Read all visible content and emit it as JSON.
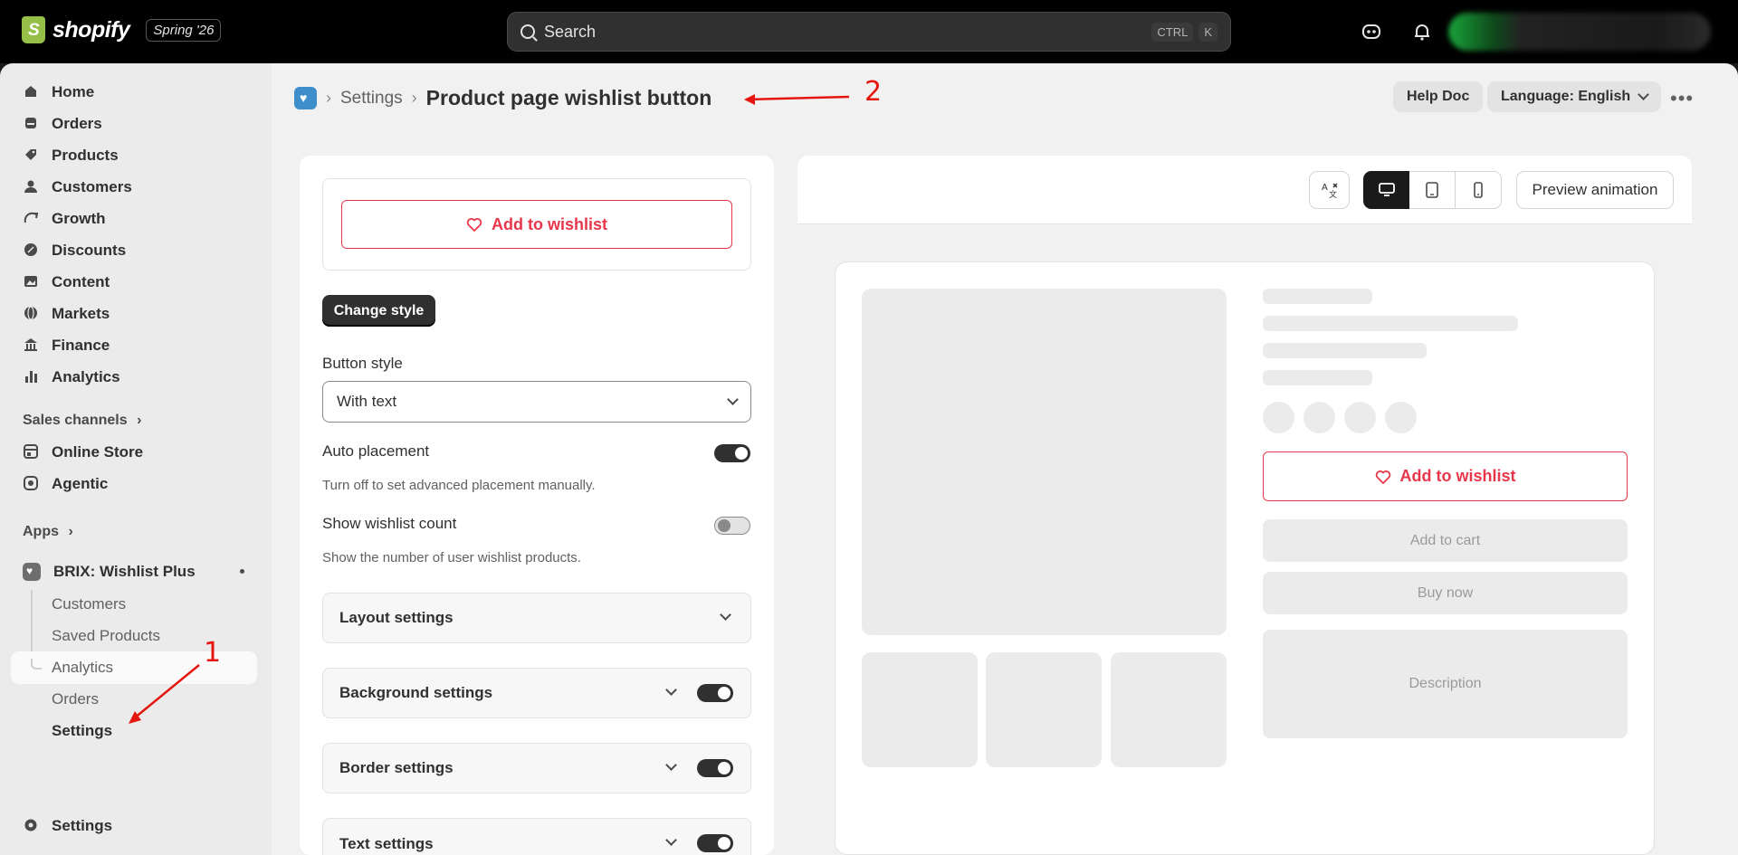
{
  "topbar": {
    "brand": "shopify",
    "edition": "Spring '26",
    "search_placeholder": "Search",
    "shortcut_ctrl": "CTRL",
    "shortcut_key": "K"
  },
  "sidebar": {
    "items": [
      {
        "label": "Home",
        "icon": "home-icon"
      },
      {
        "label": "Orders",
        "icon": "inbox-icon"
      },
      {
        "label": "Products",
        "icon": "tag-icon"
      },
      {
        "label": "Customers",
        "icon": "person-icon"
      },
      {
        "label": "Growth",
        "icon": "growth-icon"
      },
      {
        "label": "Discounts",
        "icon": "discount-icon"
      },
      {
        "label": "Content",
        "icon": "image-icon"
      },
      {
        "label": "Markets",
        "icon": "globe-icon"
      },
      {
        "label": "Finance",
        "icon": "bank-icon"
      },
      {
        "label": "Analytics",
        "icon": "bar-chart-icon"
      }
    ],
    "sales_channels_label": "Sales channels",
    "sales_channels": [
      {
        "label": "Online Store",
        "icon": "store-icon"
      },
      {
        "label": "Agentic",
        "icon": "agent-icon"
      }
    ],
    "apps_label": "Apps",
    "app_name": "BRIX: Wishlist Plus",
    "app_subitems": [
      "Customers",
      "Saved Products",
      "Analytics",
      "Orders",
      "Settings"
    ],
    "footer_settings": "Settings"
  },
  "header": {
    "crumb_settings": "Settings",
    "page_title": "Product page wishlist button",
    "help_doc": "Help Doc",
    "language": "Language: English"
  },
  "annotations": {
    "one": "1",
    "two": "2"
  },
  "settings": {
    "wishlist_label": "Add to wishlist",
    "change_style": "Change style",
    "button_style_label": "Button style",
    "button_style_value": "With text",
    "auto_placement_label": "Auto placement",
    "auto_placement_help": "Turn off to set advanced placement manually.",
    "auto_placement_on": true,
    "wishlist_count_label": "Show wishlist count",
    "wishlist_count_help": "Show the number of user wishlist products.",
    "wishlist_count_on": false,
    "sections": [
      "Layout settings",
      "Background settings",
      "Border settings",
      "Text settings"
    ]
  },
  "preview": {
    "preview_animation": "Preview animation",
    "wishlist_label": "Add to wishlist",
    "add_to_cart": "Add to cart",
    "buy_now": "Buy now",
    "description": "Description"
  },
  "colors": {
    "accent_red": "#e8374a",
    "dark": "#303030",
    "sidebar_bg": "#ebebeb"
  }
}
